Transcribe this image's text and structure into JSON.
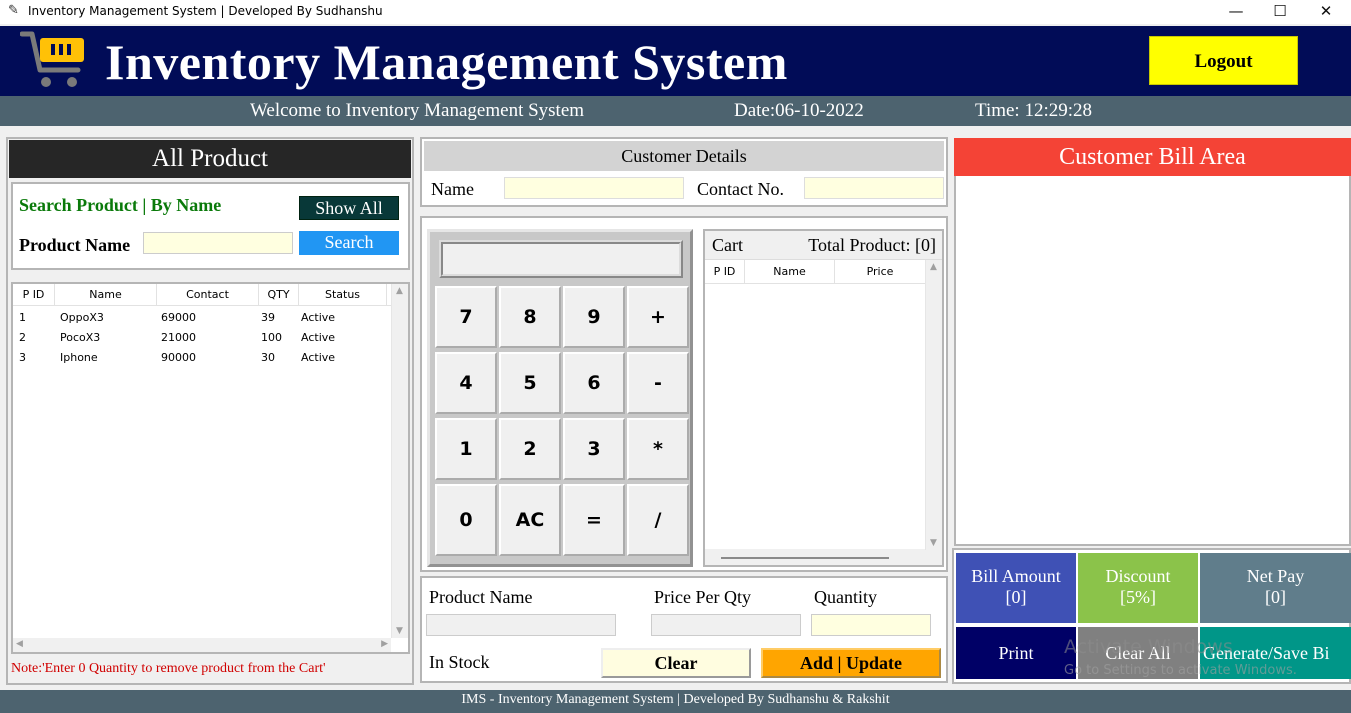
{
  "window": {
    "title": "Inventory Management System | Developed By Sudhanshu",
    "minimize_icon": "minimize-icon",
    "maximize_icon": "maximize-icon",
    "close_icon": "close-icon"
  },
  "header": {
    "title": "Inventory Management System",
    "logout_label": "Logout",
    "icon": "shopping-cart-icon"
  },
  "subheader": {
    "welcome": "Welcome to Inventory Management System",
    "date": "Date:06-10-2022",
    "time": "Time: 12:29:28"
  },
  "all_product": {
    "title": "All Product",
    "search_title": "Search Product | By Name",
    "show_all_label": "Show All",
    "product_name_label": "Product Name",
    "product_name_value": "",
    "search_label": "Search",
    "columns": [
      "P ID",
      "Name",
      "Contact",
      "QTY",
      "Status"
    ],
    "rows": [
      [
        "1",
        "OppoX3",
        "69000",
        "39",
        "Active"
      ],
      [
        "2",
        "PocoX3",
        "21000",
        "100",
        "Active"
      ],
      [
        "3",
        "Iphone",
        "90000",
        "30",
        "Active"
      ]
    ],
    "note": "Note:'Enter 0 Quantity to remove product from the Cart'"
  },
  "customer": {
    "title": "Customer Details",
    "name_label": "Name",
    "name_value": "",
    "contact_label": "Contact No.",
    "contact_value": ""
  },
  "calculator": {
    "display": "",
    "buttons": [
      "7",
      "8",
      "9",
      "+",
      "4",
      "5",
      "6",
      "-",
      "1",
      "2",
      "3",
      "*",
      "0",
      "AC",
      "=",
      "/"
    ]
  },
  "cart": {
    "title": "Cart",
    "total_label": "Total Product: [0]",
    "columns": [
      "P ID",
      "Name",
      "Price"
    ]
  },
  "product_detail": {
    "name_label": "Product Name",
    "price_label": "Price Per Qty",
    "quantity_label": "Quantity",
    "in_stock_label": "In Stock",
    "clear_label": "Clear",
    "add_update_label": "Add | Update"
  },
  "bill": {
    "title": "Customer Bill Area",
    "bill_amount_label": "Bill Amount",
    "bill_amount_value": "[0]",
    "discount_label": "Discount",
    "discount_value": "[5%]",
    "net_pay_label": "Net Pay",
    "net_pay_value": "[0]",
    "print_label": "Print",
    "clear_all_label": "Clear All",
    "generate_label": "Generate/Save Bi",
    "watermark": "Activate Windows",
    "watermark_sub": "Go to Settings to activate Windows."
  },
  "footer": {
    "text": "IMS - Inventory Management System | Developed By Sudhanshu & Rakshit"
  },
  "colors": {
    "header_bg": "#010c57",
    "subheader_bg": "#4d636f",
    "logout_bg": "#ffff00",
    "bill_head_bg": "#f44336",
    "bill_amount_bg": "#3f51b5",
    "discount_bg": "#8bc34a",
    "net_pay_bg": "#607d8b",
    "print_bg": "#000066",
    "clear_all_bg": "#808080",
    "generate_bg": "#009688",
    "add_update_bg": "#ffa500",
    "search_bg": "#2196f3"
  }
}
